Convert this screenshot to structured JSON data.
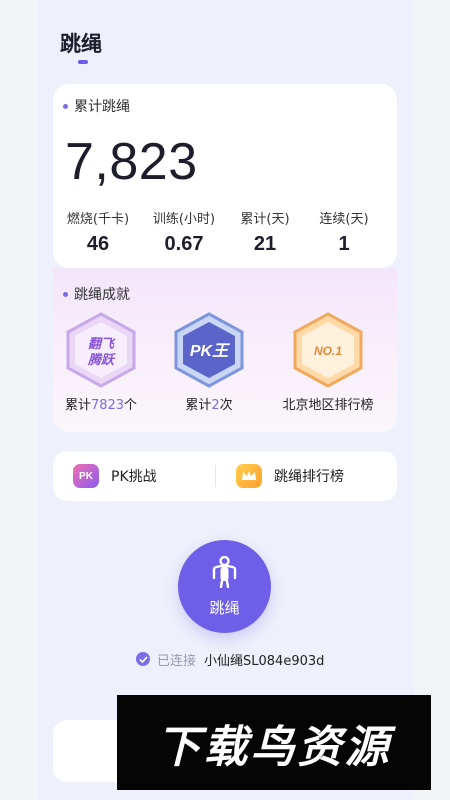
{
  "header": {
    "title": "跳绳"
  },
  "summary": {
    "label": "累计跳绳",
    "total": "7,823",
    "stats": [
      {
        "label": "燃烧(千卡)",
        "value": "46"
      },
      {
        "label": "训练(小时)",
        "value": "0.67"
      },
      {
        "label": "累计(天)",
        "value": "21"
      },
      {
        "label": "连续(天)",
        "value": "1"
      }
    ]
  },
  "achievements": {
    "label": "跳绳成就",
    "items": [
      {
        "badge_text_1": "翻飞",
        "badge_text_2": "腾跃",
        "caption_prefix": "累计",
        "caption_highlight": "7823",
        "caption_suffix": "个"
      },
      {
        "badge_text": "PK王",
        "caption_prefix": "累计",
        "caption_highlight": "2",
        "caption_suffix": "次"
      },
      {
        "badge_text": "NO.1",
        "caption": "北京地区排行榜"
      }
    ]
  },
  "actions": {
    "pk": {
      "icon_text": "PK",
      "label": "PK挑战"
    },
    "ranking": {
      "label": "跳绳排行榜"
    }
  },
  "start": {
    "label": "跳绳"
  },
  "connection": {
    "status": "已连接",
    "device": "小仙绳SL084e903d"
  },
  "watermark": {
    "text": "下载鸟资源"
  },
  "colors": {
    "accent": "#6f5fe8",
    "background": "#eef0fb"
  }
}
